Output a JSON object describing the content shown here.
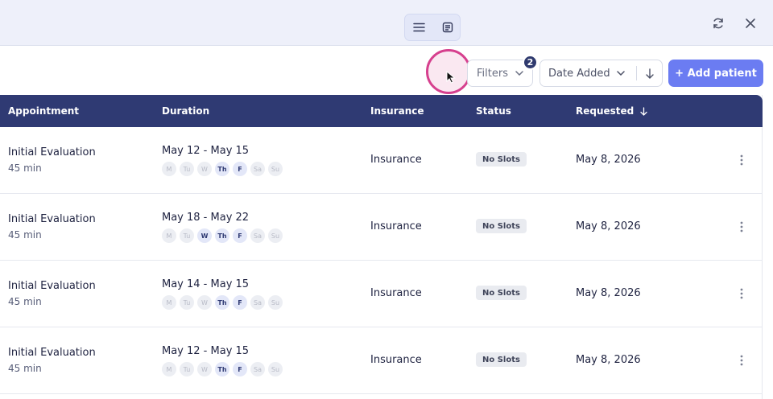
{
  "titlebar": {
    "refresh_icon": "refresh-icon",
    "close_icon": "close-icon"
  },
  "toolbar": {
    "view_list_icon": "list-view-icon",
    "view_card_icon": "card-view-icon",
    "filters_label": "Filters",
    "filters_count": "2",
    "sort_label": "Date Added",
    "add_label": "+ Add patient"
  },
  "table": {
    "columns": {
      "appointment": "Appointment",
      "duration": "Duration",
      "insurance": "Insurance",
      "status": "Status",
      "requested": "Requested"
    },
    "rows": [
      {
        "appointment": "Initial Evaluation",
        "length": "45 min",
        "dates": "May 12 - May 15",
        "days": [
          {
            "label": "M",
            "on": false
          },
          {
            "label": "Tu",
            "on": false
          },
          {
            "label": "W",
            "on": false
          },
          {
            "label": "Th",
            "on": true
          },
          {
            "label": "F",
            "on": true
          },
          {
            "label": "Sa",
            "on": false
          },
          {
            "label": "Su",
            "on": false
          }
        ],
        "insurance": "Insurance",
        "status": "No Slots",
        "requested": "May 8, 2026"
      },
      {
        "appointment": "Initial Evaluation",
        "length": "45 min",
        "dates": "May 18 - May 22",
        "days": [
          {
            "label": "M",
            "on": false
          },
          {
            "label": "Tu",
            "on": false
          },
          {
            "label": "W",
            "on": true
          },
          {
            "label": "Th",
            "on": true
          },
          {
            "label": "F",
            "on": true
          },
          {
            "label": "Sa",
            "on": false
          },
          {
            "label": "Su",
            "on": false
          }
        ],
        "insurance": "Insurance",
        "status": "No Slots",
        "requested": "May 8, 2026"
      },
      {
        "appointment": "Initial Evaluation",
        "length": "45 min",
        "dates": "May 14 - May 15",
        "days": [
          {
            "label": "M",
            "on": false
          },
          {
            "label": "Tu",
            "on": false
          },
          {
            "label": "W",
            "on": false
          },
          {
            "label": "Th",
            "on": true
          },
          {
            "label": "F",
            "on": true
          },
          {
            "label": "Sa",
            "on": false
          },
          {
            "label": "Su",
            "on": false
          }
        ],
        "insurance": "Insurance",
        "status": "No Slots",
        "requested": "May 8, 2026"
      },
      {
        "appointment": "Initial Evaluation",
        "length": "45 min",
        "dates": "May 12 - May 15",
        "days": [
          {
            "label": "M",
            "on": false
          },
          {
            "label": "Tu",
            "on": false
          },
          {
            "label": "W",
            "on": false
          },
          {
            "label": "Th",
            "on": true
          },
          {
            "label": "F",
            "on": true
          },
          {
            "label": "Sa",
            "on": false
          },
          {
            "label": "Su",
            "on": false
          }
        ],
        "insurance": "Insurance",
        "status": "No Slots",
        "requested": "May 8, 2026"
      }
    ]
  },
  "colors": {
    "header_bg": "#2f3a73",
    "accent": "#6b7cf2",
    "highlight": "#d6408e"
  }
}
